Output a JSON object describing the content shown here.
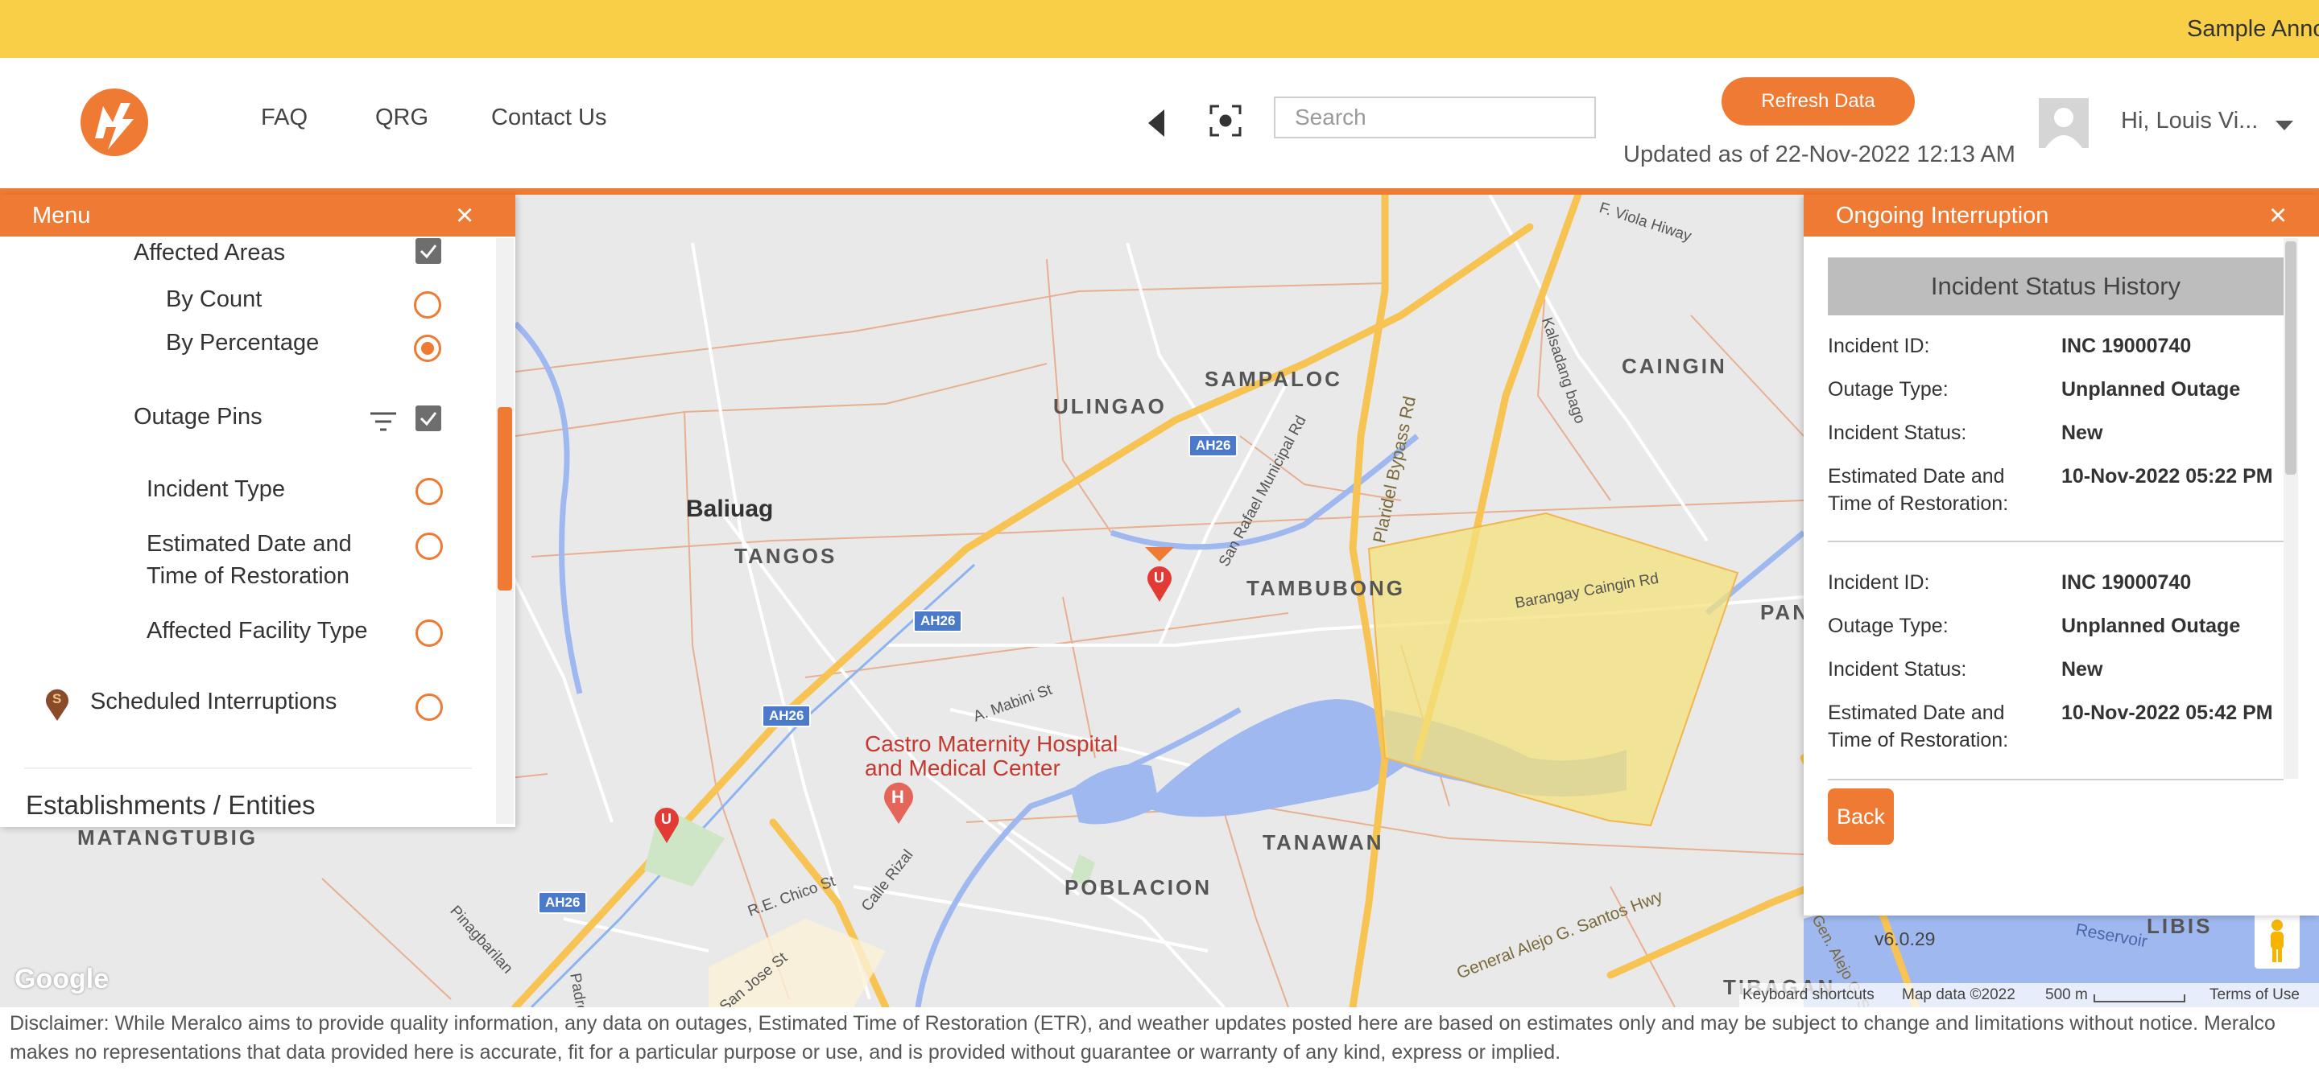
{
  "announcement": {
    "text": "Sample Anno"
  },
  "header": {
    "nav": [
      "FAQ",
      "QRG",
      "Contact Us"
    ],
    "search_placeholder": "Search",
    "refresh_label": "Refresh Data",
    "updated_text": "Updated as of 22-Nov-2022 12:13 AM",
    "greeting": "Hi, Louis Vi..."
  },
  "menu": {
    "title": "Menu",
    "close": "×",
    "affected_areas": "Affected Areas",
    "by_count": "By Count",
    "by_percentage": "By Percentage",
    "outage_pins": "Outage Pins",
    "incident_type": "Incident Type",
    "etr_line1": "Estimated Date and",
    "etr_line2": "Time of Restoration",
    "affected_facility": "Affected Facility Type",
    "scheduled": "Scheduled Interruptions",
    "scheduled_badge": "S",
    "establishments": "Establishments / Entities",
    "selected_option": "By Percentage"
  },
  "interruption": {
    "title": "Ongoing Interruption",
    "close": "×",
    "history_title": "Incident Status History",
    "labels": {
      "incident_id": "Incident ID:",
      "outage_type": "Outage Type:",
      "incident_status": "Incident Status:",
      "etr_line1": "Estimated Date and",
      "etr_line2": "Time of Restoration:"
    },
    "records": [
      {
        "incident_id": "INC 19000740",
        "outage_type": "Unplanned Outage",
        "status": "New",
        "etr": "10-Nov-2022 05:22 PM"
      },
      {
        "incident_id": "INC 19000740",
        "outage_type": "Unplanned Outage",
        "status": "New",
        "etr": "10-Nov-2022 05:42 PM"
      }
    ],
    "back_label": "Back"
  },
  "map": {
    "places": [
      "SAMPALOC",
      "ULINGAO",
      "CAINGIN",
      "Baliuag",
      "TANGOS",
      "TAMBUBONG",
      "PANT",
      "MATANGTUBIG",
      "TANAWAN",
      "POBLACION",
      "LIBIS",
      "TIBAGAN"
    ],
    "roads": [
      "Plaridel Bypass Rd",
      "San Rafael Municipal Rd",
      "Barangay Caingin Rd",
      "Kalsadang bago",
      "F. Viola Hiway",
      "A. Mabini St",
      "R.E. Chico St",
      "Calle Rizal",
      "San Jose St",
      "Pinagbarilan",
      "Padre",
      "General Alejo G. Santos Hwy",
      "Gen. Alejo G. S",
      "Reservoir"
    ],
    "road_badges": [
      "AH26",
      "AH26",
      "AH26",
      "AH26"
    ],
    "poi": "Castro Maternity Hospital and Medical Center",
    "pin_letter": "U",
    "hospital_letter": "H",
    "version": "v6.0.29",
    "google": "Google",
    "footer": {
      "shortcuts": "Keyboard shortcuts",
      "map_data": "Map data ©2022",
      "scale": "500 m",
      "terms": "Terms of Use"
    },
    "colors": {
      "road_major": "#f7c453",
      "boundary": "#e8a07a",
      "water": "#9fb8f0",
      "affected_area": "#f3e27a"
    }
  },
  "disclaimer": {
    "line1": "Disclaimer: While Meralco aims to provide quality information, any data on outages, Estimated Time of Restoration (ETR), and weather updates posted here are based on estimates only and may be subject to change and limitations without notice. Meralco",
    "line2": "makes no representations that data provided here is accurate, fit for a particular purpose or use, and is provided without guarantee or warranty of any kind, express or implied."
  },
  "colors": {
    "accent": "#ef7a33",
    "announcement": "#f9cf47"
  }
}
